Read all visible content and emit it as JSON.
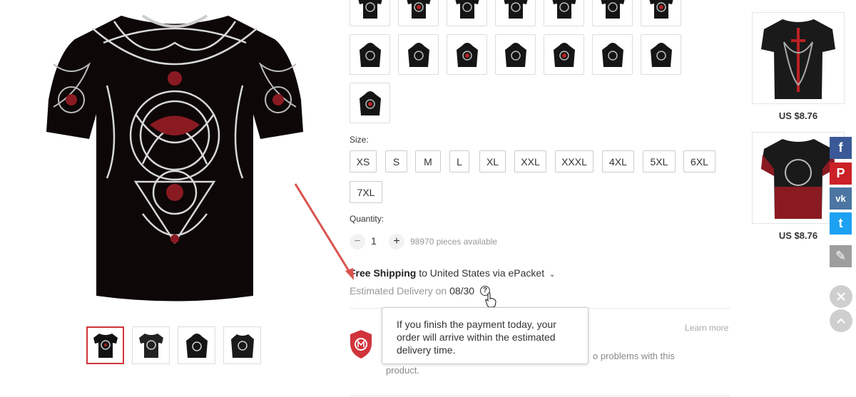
{
  "product": {
    "main_image": "viking-celtic-knot-tshirt-black-red",
    "thumbnails": [
      {
        "name": "tshirt-front",
        "active": true
      },
      {
        "name": "tshirt-alt",
        "active": false
      },
      {
        "name": "hoodie-front",
        "active": false
      },
      {
        "name": "sweatshirt-front",
        "active": false
      }
    ]
  },
  "color_swatches": [
    "tshirt",
    "tshirt-red",
    "tshirt-grey",
    "tshirt-dark",
    "tshirt-black",
    "tshirt-white-print",
    "tshirt-red-print",
    "hoodie-set-grey",
    "jacket-grey",
    "jacket-red",
    "hoodie-black",
    "hoodie-red-set",
    "hoodie-grey-set",
    "hoodie-dark",
    "hoodie-red"
  ],
  "size": {
    "label": "Size:",
    "options": [
      "XS",
      "S",
      "M",
      "L",
      "XL",
      "XXL",
      "XXXL",
      "4XL",
      "5XL",
      "6XL",
      "7XL"
    ]
  },
  "quantity": {
    "label": "Quantity:",
    "minus": "−",
    "value": "1",
    "plus": "+",
    "available": "98970 pieces available"
  },
  "shipping": {
    "free": "Free Shipping",
    "destination": "to United States via ePacket",
    "chevron": "⌄",
    "estimated_label": "Estimated Delivery on",
    "estimated_date": "08/30",
    "help": "?"
  },
  "tooltip": {
    "text": "If you finish the payment today, your order will arrive within the estimated delivery time."
  },
  "protection": {
    "learn_more": "Learn more",
    "line1": "o problems with this",
    "line2": "product."
  },
  "recommended": [
    {
      "price": "US $8.76",
      "image": "tshirt-black-dragon"
    },
    {
      "price": "US $8.76",
      "image": "tshirt-red-dragon"
    }
  ],
  "social": [
    {
      "name": "facebook",
      "glyph": "f",
      "color": "#3b5998"
    },
    {
      "name": "pinterest",
      "glyph": "P",
      "color": "#cb2027"
    },
    {
      "name": "vk",
      "glyph": "vk",
      "color": "#4c75a3"
    },
    {
      "name": "twitter",
      "glyph": "t",
      "color": "#1da1f2"
    },
    {
      "name": "edit",
      "glyph": "✎",
      "color": "#9e9e9e"
    }
  ],
  "colors": {
    "accent": "#d1343b",
    "annotation_arrow": "#d9534f"
  }
}
